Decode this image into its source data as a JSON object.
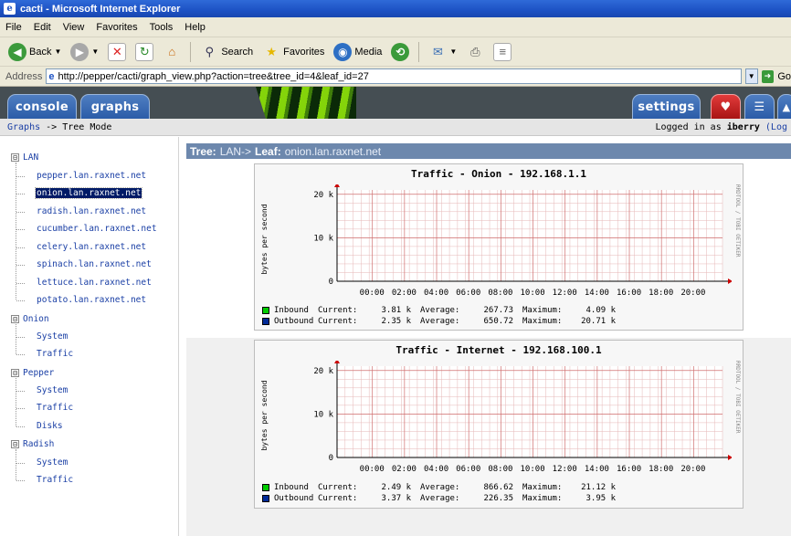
{
  "window": {
    "title": "cacti - Microsoft Internet Explorer"
  },
  "menu": [
    "File",
    "Edit",
    "View",
    "Favorites",
    "Tools",
    "Help"
  ],
  "toolbar": {
    "back": "Back",
    "search": "Search",
    "favorites": "Favorites",
    "media": "Media"
  },
  "address": {
    "label": "Address",
    "url": "http://pepper/cacti/graph_view.php?action=tree&tree_id=4&leaf_id=27",
    "go": "Go"
  },
  "tabs": {
    "console": "console",
    "graphs": "graphs",
    "settings": "settings"
  },
  "breadcrumb": {
    "graphs": "Graphs",
    "separator": "->",
    "current": "Tree Mode"
  },
  "login": {
    "text": "Logged in as",
    "user": "iberry",
    "logout": "(Log"
  },
  "tree": {
    "groups": [
      {
        "label": "LAN",
        "expander": "⊟",
        "items": [
          {
            "label": "pepper.lan.raxnet.net",
            "selected": false
          },
          {
            "label": "onion.lan.raxnet.net",
            "selected": true
          },
          {
            "label": "radish.lan.raxnet.net",
            "selected": false
          },
          {
            "label": "cucumber.lan.raxnet.net",
            "selected": false
          },
          {
            "label": "celery.lan.raxnet.net",
            "selected": false
          },
          {
            "label": "spinach.lan.raxnet.net",
            "selected": false
          },
          {
            "label": "lettuce.lan.raxnet.net",
            "selected": false
          },
          {
            "label": "potato.lan.raxnet.net",
            "selected": false
          }
        ]
      },
      {
        "label": "Onion",
        "expander": "⊟",
        "items": [
          {
            "label": "System"
          },
          {
            "label": "Traffic"
          }
        ]
      },
      {
        "label": "Pepper",
        "expander": "⊟",
        "items": [
          {
            "label": "System"
          },
          {
            "label": "Traffic"
          },
          {
            "label": "Disks"
          }
        ]
      },
      {
        "label": "Radish",
        "expander": "⊟",
        "items": [
          {
            "label": "System"
          },
          {
            "label": "Traffic"
          }
        ]
      }
    ]
  },
  "main": {
    "tree_label": "Tree:",
    "tree_path": "LAN->",
    "leaf_label": "Leaf:",
    "leaf_name": "onion.lan.raxnet.net"
  },
  "graph_common": {
    "ylabel": "bytes per second",
    "side_text": "RRDTOOL / TOBI OETIKER",
    "yticks": [
      "20 k",
      "10 k",
      "0"
    ],
    "xticks": [
      "00:00",
      "02:00",
      "04:00",
      "06:00",
      "08:00",
      "10:00",
      "12:00",
      "14:00",
      "16:00",
      "18:00",
      "20:00"
    ]
  },
  "graphs": [
    {
      "title": "Traffic - Onion - 192.168.1.1",
      "legend": [
        {
          "name": "Inbound",
          "current_k": "Current:",
          "current": "3.81 k",
          "avg_k": "Average:",
          "average": "267.73",
          "max_k": "Maximum:",
          "maximum": "4.09 k"
        },
        {
          "name": "Outbound",
          "current_k": "Current:",
          "current": "2.35 k",
          "avg_k": "Average:",
          "average": "650.72",
          "max_k": "Maximum:",
          "maximum": "20.71 k"
        }
      ]
    },
    {
      "title": "Traffic - Internet - 192.168.100.1",
      "legend": [
        {
          "name": "Inbound",
          "current_k": "Current:",
          "current": "2.49 k",
          "avg_k": "Average:",
          "average": "866.62",
          "max_k": "Maximum:",
          "maximum": "21.12 k"
        },
        {
          "name": "Outbound",
          "current_k": "Current:",
          "current": "3.37 k",
          "avg_k": "Average:",
          "average": "226.35",
          "max_k": "Maximum:",
          "maximum": "3.95 k"
        }
      ]
    }
  ],
  "chart_data": [
    {
      "type": "area",
      "title": "Traffic - Onion - 192.168.1.1",
      "ylabel": "bytes per second",
      "ylim": [
        0,
        21000
      ],
      "x": [
        "00:00",
        "02:00",
        "04:00",
        "06:00",
        "08:00",
        "10:00",
        "12:00",
        "14:00",
        "16:00",
        "18:00",
        "20:00"
      ],
      "series": [
        {
          "name": "Inbound",
          "color": "#00cc00"
        },
        {
          "name": "Outbound",
          "color": "#002a97"
        }
      ]
    },
    {
      "type": "area",
      "title": "Traffic - Internet - 192.168.100.1",
      "ylabel": "bytes per second",
      "ylim": [
        0,
        21000
      ],
      "x": [
        "00:00",
        "02:00",
        "04:00",
        "06:00",
        "08:00",
        "10:00",
        "12:00",
        "14:00",
        "16:00",
        "18:00",
        "20:00"
      ],
      "series": [
        {
          "name": "Inbound",
          "color": "#00cc00"
        },
        {
          "name": "Outbound",
          "color": "#002a97"
        }
      ]
    }
  ],
  "colors": {
    "inbound": "#00cc00",
    "outbound": "#002a97",
    "header_bg": "#454e53",
    "tab_blue": "#2b5ca8",
    "leaf_header": "#6d88ad"
  }
}
